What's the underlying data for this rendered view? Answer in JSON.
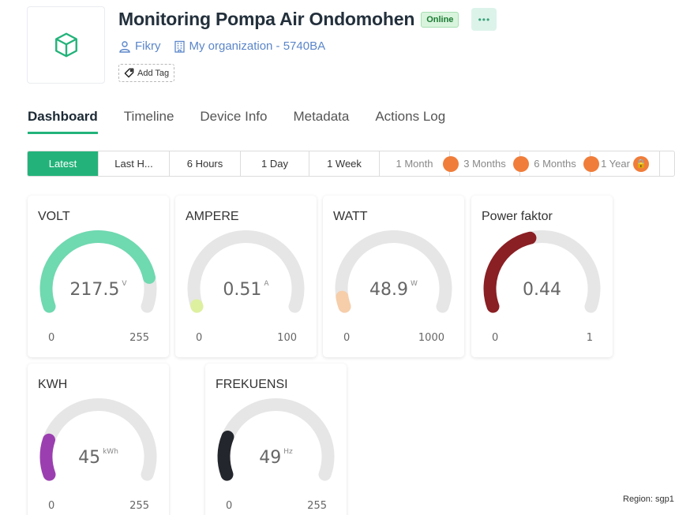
{
  "device": {
    "title": "Monitoring Pompa Air Ondomohen",
    "status": "Online",
    "more_label": "•••",
    "owner": "Fikry",
    "organization": "My organization - 5740BA",
    "add_tag_label": "Add Tag",
    "logo_icon": "cube-icon",
    "accent_color": "#23b37a"
  },
  "tabs": [
    {
      "label": "Dashboard",
      "active": true
    },
    {
      "label": "Timeline"
    },
    {
      "label": "Device Info"
    },
    {
      "label": "Metadata"
    },
    {
      "label": "Actions Log"
    }
  ],
  "time_ranges": [
    {
      "label": "Latest",
      "active": true
    },
    {
      "label": "Last H..."
    },
    {
      "label": "6 Hours"
    },
    {
      "label": "1 Day"
    },
    {
      "label": "1 Week"
    },
    {
      "label": "1 Month",
      "locked": true
    },
    {
      "label": "3 Months",
      "locked": true
    },
    {
      "label": "6 Months",
      "locked": true
    },
    {
      "label": "1 Year",
      "locked": true
    }
  ],
  "gauges": [
    {
      "title": "VOLT",
      "value": "217.5",
      "unit": "V",
      "min": "0",
      "max": "255",
      "fraction": 0.853,
      "color": "#6fd9b0"
    },
    {
      "title": "AMPERE",
      "value": "0.51",
      "unit": "A",
      "min": "0",
      "max": "100",
      "fraction": 0.0051,
      "color": "#ddf0a0"
    },
    {
      "title": "WATT",
      "value": "48.9",
      "unit": "W",
      "min": "0",
      "max": "1000",
      "fraction": 0.0489,
      "color": "#f6ceaa"
    },
    {
      "title": "Power faktor",
      "value": "0.44",
      "unit": "",
      "min": "0",
      "max": "1",
      "fraction": 0.44,
      "color": "#8a1f24"
    },
    {
      "title": "KWH",
      "value": "45",
      "unit": "kWh",
      "min": "0",
      "max": "255",
      "fraction": 0.176,
      "color": "#9b3fb0"
    },
    {
      "title": "FREKUENSI",
      "value": "49",
      "unit": "Hz",
      "min": "0",
      "max": "255",
      "fraction": 0.192,
      "color": "#23262d"
    }
  ],
  "footer": {
    "region": "Region: sgp1"
  }
}
